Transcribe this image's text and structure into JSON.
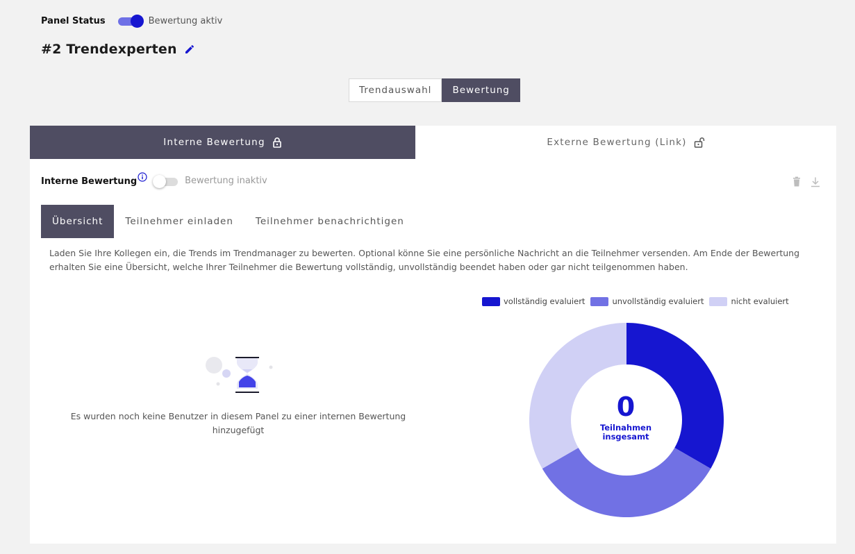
{
  "panel_status": {
    "label": "Panel Status",
    "toggle_text": "Bewertung aktiv",
    "toggle_on": true
  },
  "panel": {
    "title": "#2 Trendexperten"
  },
  "view_switch": {
    "options": [
      "Trendauswahl",
      "Bewertung"
    ],
    "selected": "Bewertung"
  },
  "rating_tabs": {
    "internal_label": "Interne Bewertung",
    "external_label": "Externe Bewertung (Link)",
    "selected": "Interne Bewertung"
  },
  "internal_rating": {
    "label": "Interne Bewertung",
    "toggle_text": "Bewertung inaktiv",
    "toggle_on": false
  },
  "sub_tabs": {
    "overview": "Übersicht",
    "invite": "Teilnehmer einladen",
    "notify": "Teilnehmer benachrichtigen",
    "selected": "Übersicht"
  },
  "description": {
    "line1": "Laden Sie Ihre Kollegen ein, die Trends im Trendmanager zu bewerten. Optional könne Sie eine persönliche Nachricht an die Teilnehmer versenden. Am Ende der Bewertung",
    "line2": "erhalten Sie eine Übersicht, welche Ihrer Teilnehmer die Bewertung vollständig, unvollständig beendet haben oder gar nicht teilgenommen haben."
  },
  "empty_state": {
    "line1": "Es wurden noch keine Benutzer in diesem Panel zu einer internen Bewertung",
    "line2": "hinzugefügt",
    "icon": "hourglass-icon"
  },
  "colors": {
    "accent": "#1616d0",
    "dark": "#4f4d62"
  },
  "chart_data": {
    "type": "pie",
    "categories": [
      "vollständig evaluiert",
      "unvollständig evaluiert",
      "nicht evaluiert"
    ],
    "values": [
      1,
      1,
      1
    ],
    "colors": [
      "#1616d0",
      "#7171e4",
      "#d0d0f5"
    ],
    "legend": "top",
    "center_value": "0",
    "center_label": "Teilnahmen insgesamt"
  }
}
